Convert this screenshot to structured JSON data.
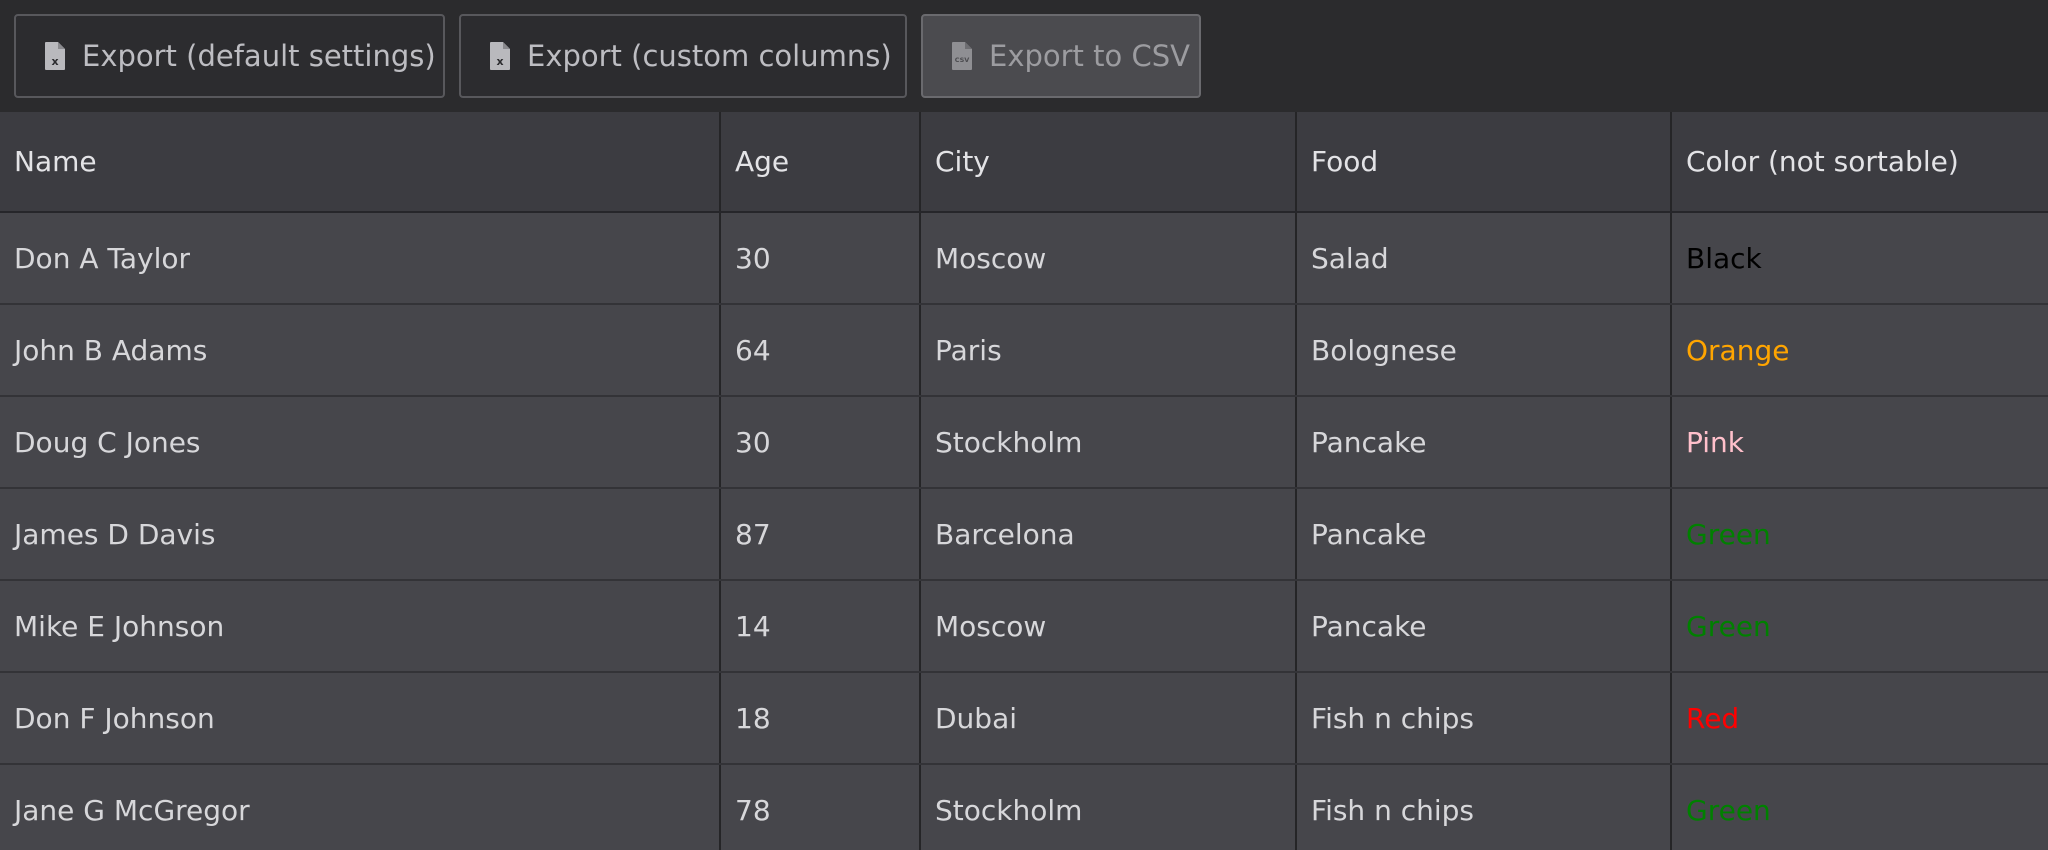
{
  "toolbar": {
    "buttons": [
      {
        "label": "Export (default settings)",
        "icon": "excel-file-icon"
      },
      {
        "label": "Export (custom columns)",
        "icon": "excel-file-icon"
      },
      {
        "label": "Export to CSV",
        "icon": "csv-file-icon"
      }
    ]
  },
  "table": {
    "headers": [
      "Name",
      "Age",
      "City",
      "Food",
      "Color (not sortable)"
    ],
    "rows": [
      {
        "name": "Don A Taylor",
        "age": "30",
        "city": "Moscow",
        "food": "Salad",
        "color": "Black",
        "color_hex": "#000000"
      },
      {
        "name": "John B Adams",
        "age": "64",
        "city": "Paris",
        "food": "Bolognese",
        "color": "Orange",
        "color_hex": "#ffa500"
      },
      {
        "name": "Doug C Jones",
        "age": "30",
        "city": "Stockholm",
        "food": "Pancake",
        "color": "Pink",
        "color_hex": "#ffc0cb"
      },
      {
        "name": "James D Davis",
        "age": "87",
        "city": "Barcelona",
        "food": "Pancake",
        "color": "Green",
        "color_hex": "#008000"
      },
      {
        "name": "Mike E Johnson",
        "age": "14",
        "city": "Moscow",
        "food": "Pancake",
        "color": "Green",
        "color_hex": "#008000"
      },
      {
        "name": "Don F Johnson",
        "age": "18",
        "city": "Dubai",
        "food": "Fish n chips",
        "color": "Red",
        "color_hex": "#ff0000"
      },
      {
        "name": "Jane G McGregor",
        "age": "78",
        "city": "Stockholm",
        "food": "Fish n chips",
        "color": "Green",
        "color_hex": "#008000"
      }
    ]
  }
}
